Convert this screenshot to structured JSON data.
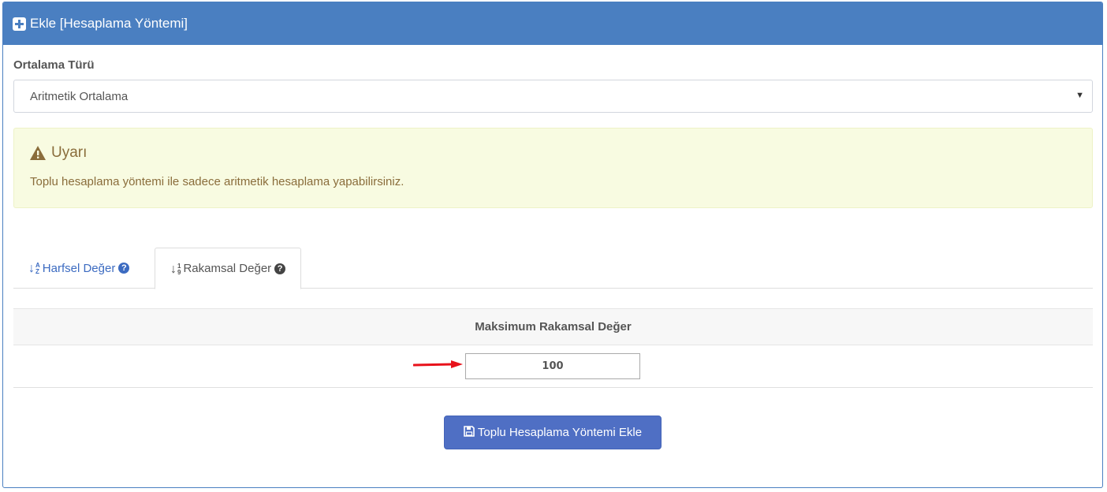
{
  "panel": {
    "title": "Ekle [Hesaplama Yöntemi]"
  },
  "form": {
    "average_type_label": "Ortalama Türü",
    "average_type_value": "Aritmetik Ortalama"
  },
  "alert": {
    "title": "Uyarı",
    "message": "Toplu hesaplama yöntemi ile sadece aritmetik hesaplama yapabilirsiniz."
  },
  "tabs": [
    {
      "label": "Harfsel Değer",
      "icon": "sort-alpha-icon",
      "active": false
    },
    {
      "label": "Rakamsal Değer",
      "icon": "sort-numeric-icon",
      "active": true
    }
  ],
  "sort_glyphs": {
    "alpha_top": "A",
    "alpha_bottom": "Z",
    "numeric_top": "1",
    "numeric_bottom": "9"
  },
  "table": {
    "header": "Maksimum Rakamsal Değer",
    "value": "100"
  },
  "submit_button": {
    "label": "Toplu Hesaplama Yöntemi Ekle",
    "icon": "save-icon"
  },
  "colors": {
    "header_bg": "#4a7fc1",
    "alert_bg": "#f8fbe1",
    "alert_text": "#8a6d3b",
    "button_bg": "#4f6fc4",
    "arrow": "#e8121b"
  }
}
